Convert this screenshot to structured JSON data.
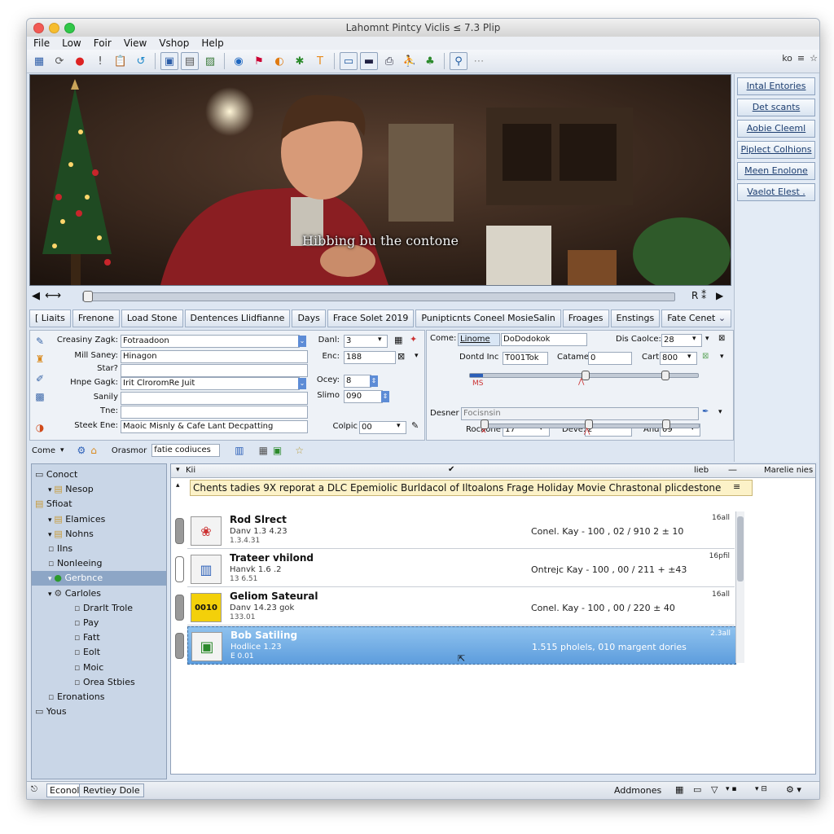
{
  "window": {
    "title": "Lahomnt Pintcy Viclis ≤ 7.3 Plip"
  },
  "menu": [
    "File",
    "Low",
    "Foir",
    "View",
    "Vshop",
    "Help"
  ],
  "toolbar_right": [
    "ko",
    "≡",
    "☆"
  ],
  "video": {
    "subtitle": "Hibbing bu the contone"
  },
  "side_buttons": [
    "Intal Entories",
    "Det scants",
    "Aobie Cleeml",
    "Piplect Colhions",
    "Meen Enolone",
    "Vaelot Elest ."
  ],
  "seek": {
    "right_label": "R ⁑"
  },
  "tabs": [
    "[ Liaits",
    "Frenone",
    "Load Stone",
    "Dentences Llidfianne",
    "Days",
    "Frace Solet 2019",
    "Punipticnts Coneel MosieSalin",
    "Froages",
    "Enstings",
    "Fate Cenet"
  ],
  "form_left": {
    "fields": [
      {
        "label": "Creasiny Zagk:",
        "value": "Fotraadoon"
      },
      {
        "label": "Mill Saney:",
        "value": "Hinagon"
      },
      {
        "label": "Star?",
        "value": ""
      },
      {
        "label": "Hnpe Gagk:",
        "value": "Irit ClroromRe Juit"
      },
      {
        "label": "Sanily",
        "value": ""
      },
      {
        "label": "Tne:",
        "value": ""
      },
      {
        "label": "Steek Ene:",
        "value": "Maoic Misnly & Cafe Lant Decpatting"
      }
    ],
    "right_fields": [
      {
        "label": "Danl:",
        "value": "3"
      },
      {
        "label": "Enc:",
        "value": "188"
      },
      {
        "label": "Ocey:",
        "value": "8"
      },
      {
        "label": "Slimo",
        "value": "090"
      },
      {
        "label": "Colpic",
        "value": "00"
      }
    ]
  },
  "form_right": {
    "come_label": "Come:",
    "come_tab": "Linome",
    "come_value": "DoDodokok",
    "dis_label": "Dis Caolce:",
    "dis_value": "28",
    "dontd_label": "Dontd Inc",
    "dontd_value": "T001Tok",
    "catame_label": "Catame",
    "catame_value": "0",
    "cart_label": "Cart",
    "cart_value": "800",
    "slider_label": "MS",
    "desner_label": "Desner",
    "desner_value": "Focisnsin",
    "ractone_label": "Rocaone",
    "ractone_value": "17",
    "deve_label": "Deve:",
    "deve_value": "2",
    "and_label": "And",
    "and_value": "09"
  },
  "filterbar": {
    "come": "Come",
    "orasmor_label": "Orasmor",
    "orasmor_value": "fatie codiuces"
  },
  "tree": [
    {
      "label": "Conoct",
      "indent": 0,
      "icon": "disk"
    },
    {
      "label": "Nesop",
      "indent": 1,
      "icon": "folder"
    },
    {
      "label": "Sfioat",
      "indent": 0,
      "icon": "folder"
    },
    {
      "label": "Elamices",
      "indent": 1,
      "icon": "folder"
    },
    {
      "label": "Nohns",
      "indent": 1,
      "icon": "folder"
    },
    {
      "label": "IIns",
      "indent": 1,
      "icon": "file"
    },
    {
      "label": "Nonleeing",
      "indent": 1,
      "icon": "file"
    },
    {
      "label": "Gerbnce",
      "indent": 1,
      "icon": "green"
    },
    {
      "label": "Carloles",
      "indent": 1,
      "icon": "gear"
    },
    {
      "label": "Drarlt Trole",
      "indent": 2,
      "icon": "file"
    },
    {
      "label": "Pay",
      "indent": 2,
      "icon": "file"
    },
    {
      "label": "Fatt",
      "indent": 2,
      "icon": "file"
    },
    {
      "label": "Eolt",
      "indent": 2,
      "icon": "file"
    },
    {
      "label": "Moic",
      "indent": 2,
      "icon": "file"
    },
    {
      "label": "Orea Stbies",
      "indent": 2,
      "icon": "file"
    },
    {
      "label": "Eronations",
      "indent": 1,
      "icon": "file"
    },
    {
      "label": "Yous",
      "indent": 0,
      "icon": "disk"
    }
  ],
  "list": {
    "header_left": "Kii",
    "header_mid": "lieb",
    "header_right": "Marelie nies",
    "banner": "Chents tadies 9X reporat a DLC Epemiolic Burldacol of Iltoalons Frage Holiday Movie Chrastonal plicdestone",
    "rows": [
      {
        "title": "Rod Slrect",
        "sub": "Danv 1.3 4.23",
        "sub2": "1.3.4.31",
        "info": "Conel. Kay  - 100 , 02 / 910  2  ± 10",
        "badge": "16all",
        "thumb": "flower"
      },
      {
        "title": "Trateer vhilond",
        "sub": "Hanvk 1.6 .2",
        "sub2": "13 6.51",
        "info": "Ontrejc Kay  - 100 , 00 / 211  +  ±43",
        "badge": "16pfil",
        "thumb": "chart"
      },
      {
        "title": "Geliom Sateural",
        "sub": "Danv 14.23 gok",
        "sub2": "133.01",
        "info": "Conel. Kay  - 100 , 00 / 220  ±  40",
        "badge": "16all",
        "thumb": "0010"
      },
      {
        "title": "Bob Satiling",
        "sub": "Hodlice 1.23",
        "sub2": "E 0.01",
        "info": "1.515 pholels, 010 margent dories",
        "badge": "2.3all",
        "thumb": "photo"
      }
    ]
  },
  "status": {
    "tab1": "Econol",
    "tab2": "Revtiey Dole",
    "right": "Addmones"
  }
}
